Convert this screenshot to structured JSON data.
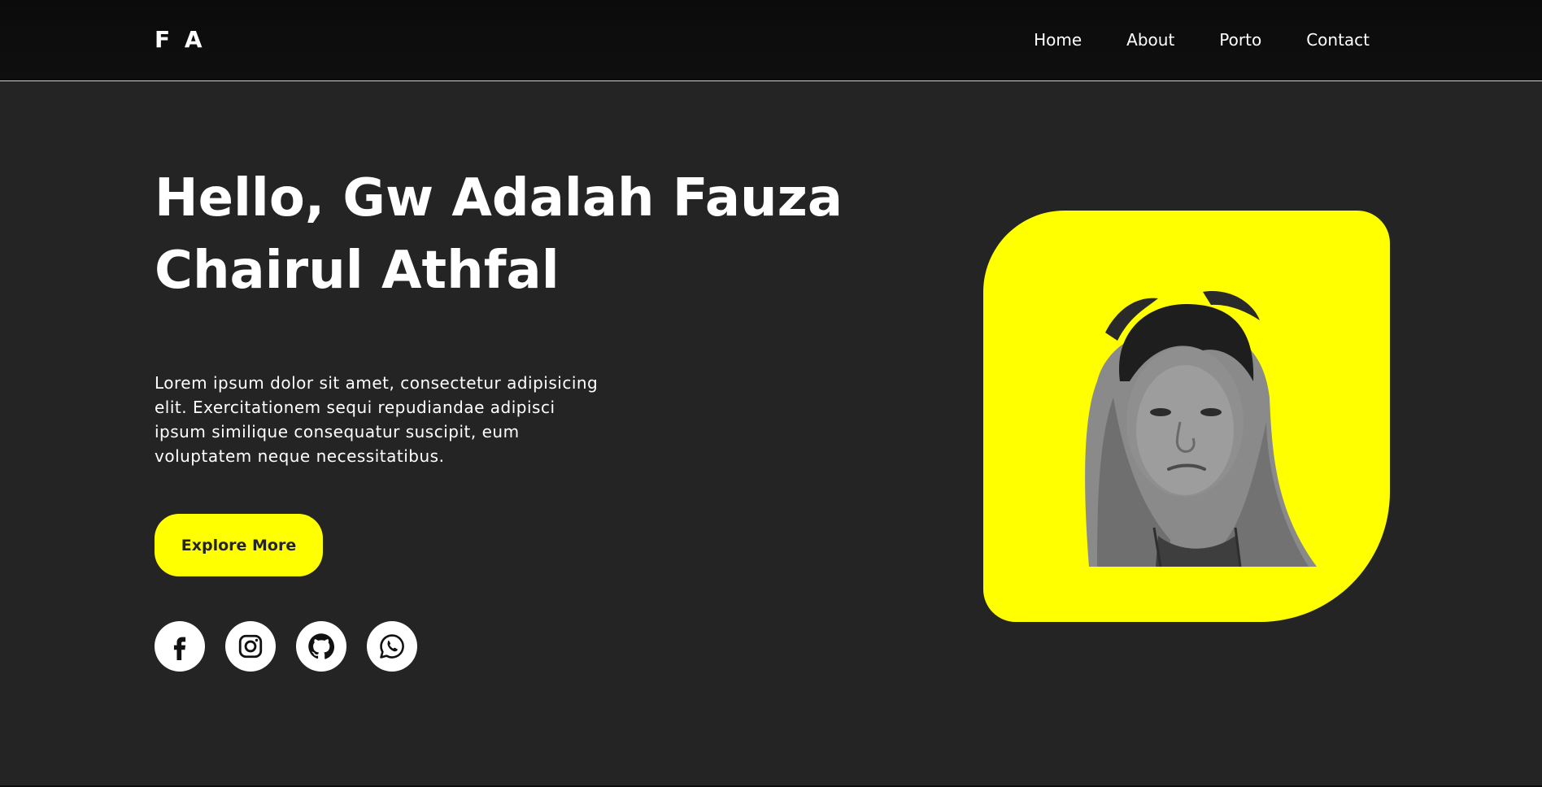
{
  "brand": {
    "logo_text": "F A"
  },
  "nav": {
    "items": [
      {
        "label": "Home"
      },
      {
        "label": "About"
      },
      {
        "label": "Porto"
      },
      {
        "label": "Contact"
      }
    ]
  },
  "hero": {
    "title_line1": "Hello, Gw Adalah Fauza",
    "title_line2": "Chairul Athfal",
    "description": "Lorem ipsum dolor sit amet, consectetur adipisicing elit. Exercitationem sequi repudiandae adipisci ipsum similique consequatur suscipit, eum voluptatem neque necessitatibus.",
    "cta_label": "Explore More"
  },
  "socials": [
    {
      "icon": "facebook-icon"
    },
    {
      "icon": "instagram-icon"
    },
    {
      "icon": "github-icon"
    },
    {
      "icon": "whatsapp-icon"
    }
  ],
  "theme": {
    "background": "#242424",
    "navbar": "#0d0d0d",
    "accent": "#ffff00",
    "text": "#ffffff"
  }
}
